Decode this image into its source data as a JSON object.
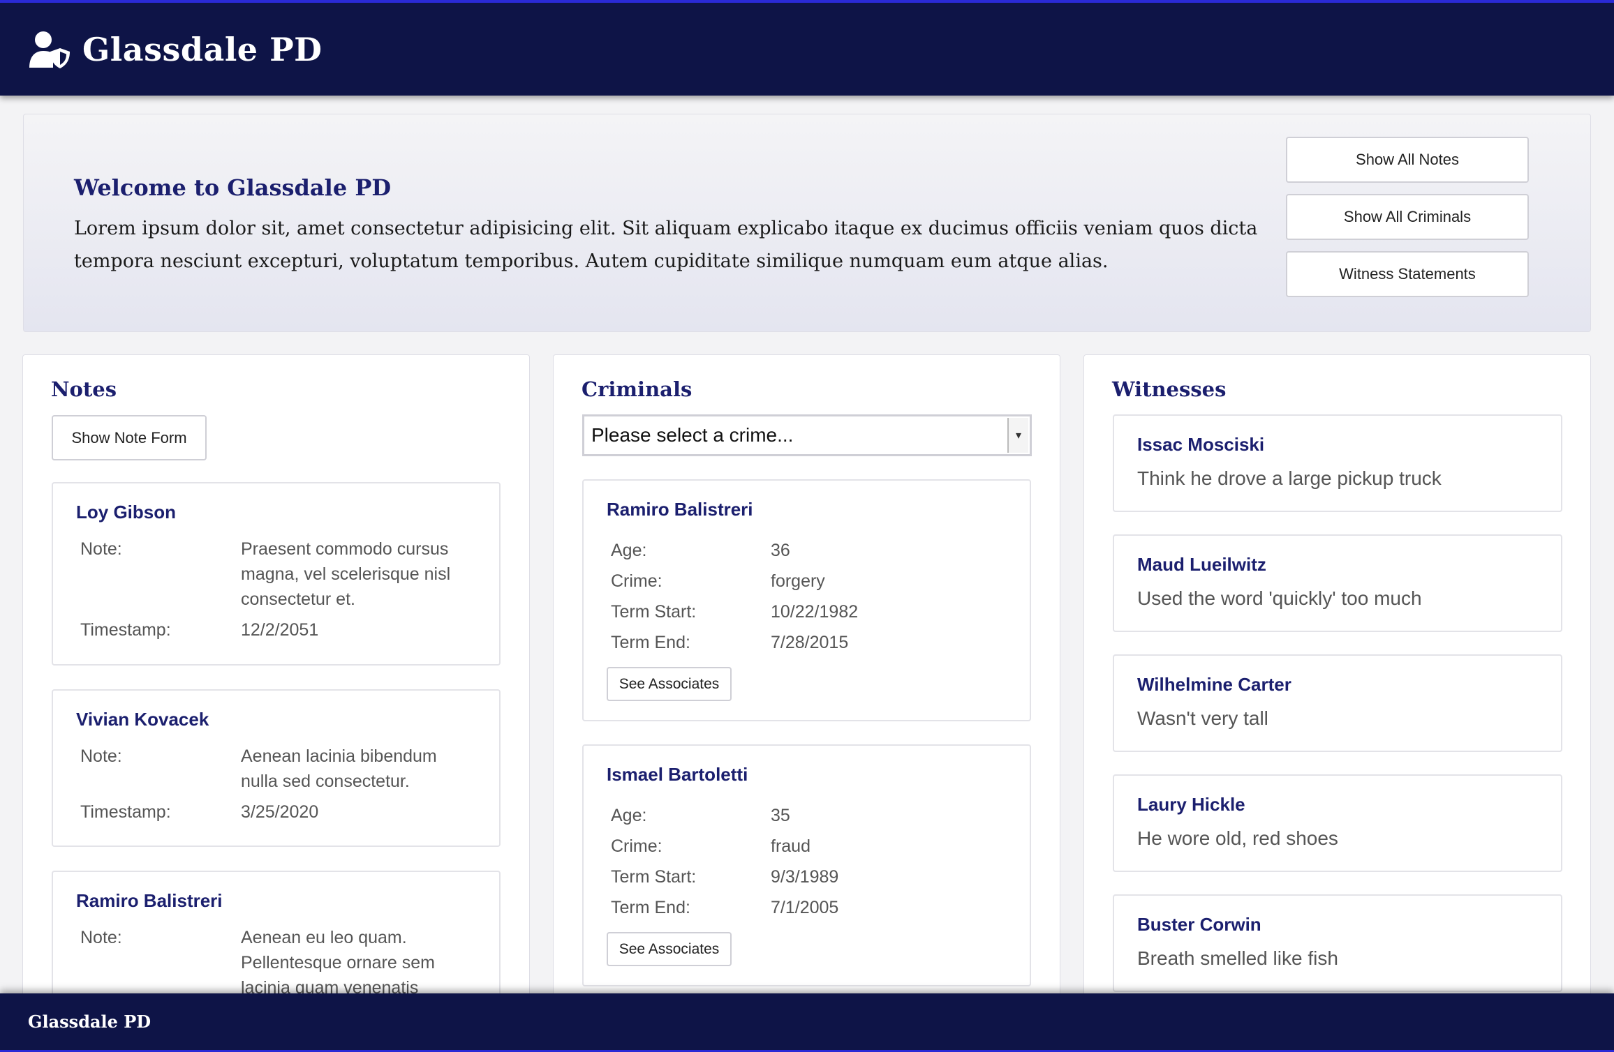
{
  "header": {
    "title": "Glassdale PD",
    "icon": "user-shield-icon"
  },
  "welcome": {
    "title": "Welcome to Glassdale PD",
    "text": "Lorem ipsum dolor sit, amet consectetur adipisicing elit. Sit aliquam explicabo itaque ex ducimus officiis veniam quos dicta tempora nesciunt excepturi, voluptatum temporibus. Autem cupiditate similique numquam eum atque alias.",
    "buttons": [
      "Show All Notes",
      "Show All Criminals",
      "Witness Statements"
    ]
  },
  "notes": {
    "title": "Notes",
    "show_form_label": "Show Note Form",
    "note_label": "Note:",
    "timestamp_label": "Timestamp:",
    "items": [
      {
        "name": "Loy Gibson",
        "note": "Praesent commodo cursus magna, vel scelerisque nisl consectetur et.",
        "timestamp": "12/2/2051"
      },
      {
        "name": "Vivian Kovacek",
        "note": "Aenean lacinia bibendum nulla sed consectetur.",
        "timestamp": "3/25/2020"
      },
      {
        "name": "Ramiro Balistreri",
        "note": "Aenean eu leo quam. Pellentesque ornare sem lacinia quam venenatis",
        "timestamp": ""
      }
    ]
  },
  "criminals": {
    "title": "Criminals",
    "select_placeholder": "Please select a crime...",
    "labels": {
      "age": "Age:",
      "crime": "Crime:",
      "term_start": "Term Start:",
      "term_end": "Term End:"
    },
    "associates_label": "See Associates",
    "items": [
      {
        "name": "Ramiro Balistreri",
        "age": "36",
        "crime": "forgery",
        "term_start": "10/22/1982",
        "term_end": "7/28/2015"
      },
      {
        "name": "Ismael Bartoletti",
        "age": "35",
        "crime": "fraud",
        "term_start": "9/3/1989",
        "term_end": "7/1/2005"
      }
    ]
  },
  "witnesses": {
    "title": "Witnesses",
    "items": [
      {
        "name": "Issac Mosciski",
        "statement": "Think he drove a large pickup truck"
      },
      {
        "name": "Maud Lueilwitz",
        "statement": "Used the word 'quickly' too much"
      },
      {
        "name": "Wilhelmine Carter",
        "statement": "Wasn't very tall"
      },
      {
        "name": "Laury Hickle",
        "statement": "He wore old, red shoes"
      },
      {
        "name": "Buster Corwin",
        "statement": "Breath smelled like fish"
      }
    ]
  },
  "footer": {
    "title": "Glassdale PD"
  },
  "colors": {
    "navy": "#0e1447",
    "accent_text": "#1b1f6e",
    "border_accent": "#2a2ad6"
  }
}
